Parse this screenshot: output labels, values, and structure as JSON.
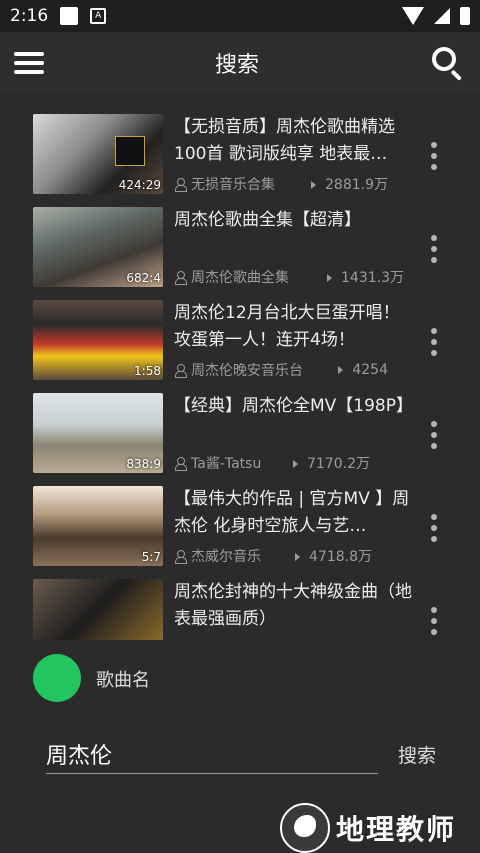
{
  "status": {
    "time": "2:16",
    "a_icon": "A"
  },
  "appbar": {
    "title": "搜索"
  },
  "list": [
    {
      "title": "【无损音质】周杰伦歌曲精选100首 歌词版纯享 地表最…",
      "duration": "424:29",
      "channel": "无损音乐合集",
      "views": "2881.9万"
    },
    {
      "title": "周杰伦歌曲全集【超清】",
      "duration": "682:4",
      "channel": "周杰伦歌曲全集",
      "views": "1431.3万"
    },
    {
      "title": "周杰伦12月台北大巨蛋开唱！攻蛋第一人！连开4场！",
      "duration": "1:58",
      "channel": "周杰伦晚安音乐台",
      "views": "4254"
    },
    {
      "title": "【经典】周杰伦全MV【198P】",
      "duration": "838:9",
      "channel": "Ta酱-Tatsu",
      "views": "7170.2万"
    },
    {
      "title": "【最伟大的作品 | 官方MV 】周杰伦 化身时空旅人与艺…",
      "duration": "5:7",
      "channel": "杰威尔音乐",
      "views": "4718.8万"
    },
    {
      "title": "周杰伦封神的十大神级金曲（地表最强画质）",
      "duration": "",
      "channel": "",
      "views": ""
    }
  ],
  "player": {
    "song_name": "歌曲名"
  },
  "search": {
    "value": "周杰伦",
    "button": "搜索"
  },
  "watermark": {
    "text": "地理教师"
  },
  "colors": {
    "accent": "#22c55e"
  },
  "icons": [
    "menu-icon",
    "search-icon",
    "more-vert-icon",
    "person-icon",
    "play-count-icon"
  ]
}
